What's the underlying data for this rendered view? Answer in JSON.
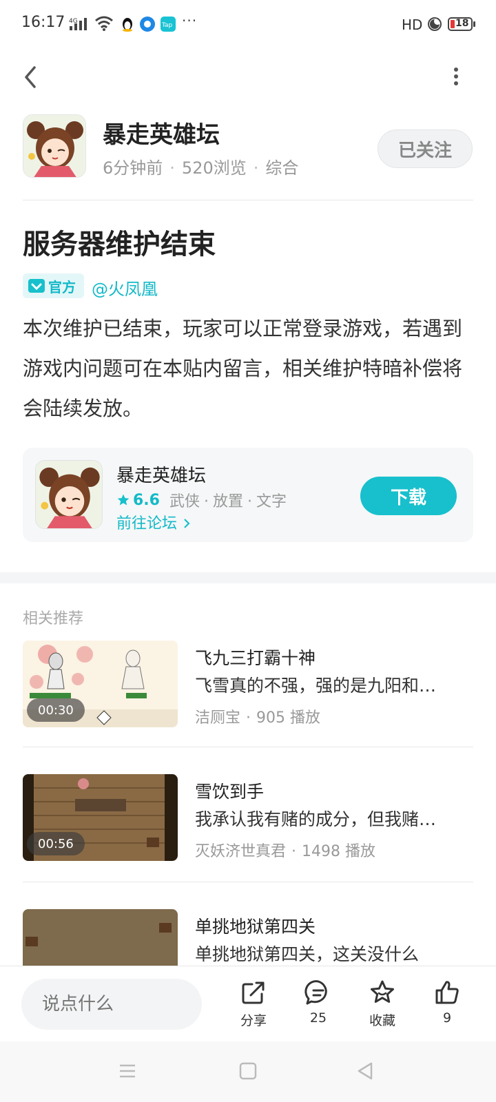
{
  "status_bar": {
    "time": "16:17",
    "network_label": "4G",
    "hd_label": "HD",
    "battery_level": "18",
    "more_indicator": "···",
    "notification_icons": [
      "penguin-icon",
      "messenger-icon",
      "tap-icon"
    ]
  },
  "forum": {
    "name": "暴走英雄坛",
    "time_ago": "6分钟前",
    "views": "520浏览",
    "category": "综合",
    "follow_label": "已关注"
  },
  "post": {
    "title": "服务器维护结束",
    "badge_label": "官方",
    "author": "@火凤凰",
    "body": "本次维护已结束，玩家可以正常登录游戏，若遇到游戏内问题可在本贴内留言，相关维护特暗补偿将会陆续发放。"
  },
  "app_card": {
    "name": "暴走英雄坛",
    "rating": "6.6",
    "tags": [
      "武侠",
      "放置",
      "文字"
    ],
    "forum_link": "前往论坛",
    "download_label": "下载"
  },
  "recommendations": {
    "section_title": "相关推荐",
    "items": [
      {
        "title": "飞九三打霸十神",
        "desc": "飞雪真的不强，强的是九阳和…",
        "author": "洁厕宝",
        "plays": "905 播放",
        "duration": "00:30"
      },
      {
        "title": "雪饮到手",
        "desc": "我承认我有赌的成分，但我赌…",
        "author": "灭妖济世真君",
        "plays": "1498 播放",
        "duration": "00:56"
      },
      {
        "title": "单挑地狱第四关",
        "desc": "单挑地狱第四关，这关没什么",
        "author": "",
        "plays": "",
        "duration": ""
      }
    ]
  },
  "action_bar": {
    "comment_placeholder": "说点什么",
    "share_label": "分享",
    "comment_count": "25",
    "favorite_label": "收藏",
    "like_count": "9"
  },
  "colors": {
    "accent": "#17c0cc",
    "text_primary": "#222222",
    "text_secondary": "#999999"
  }
}
